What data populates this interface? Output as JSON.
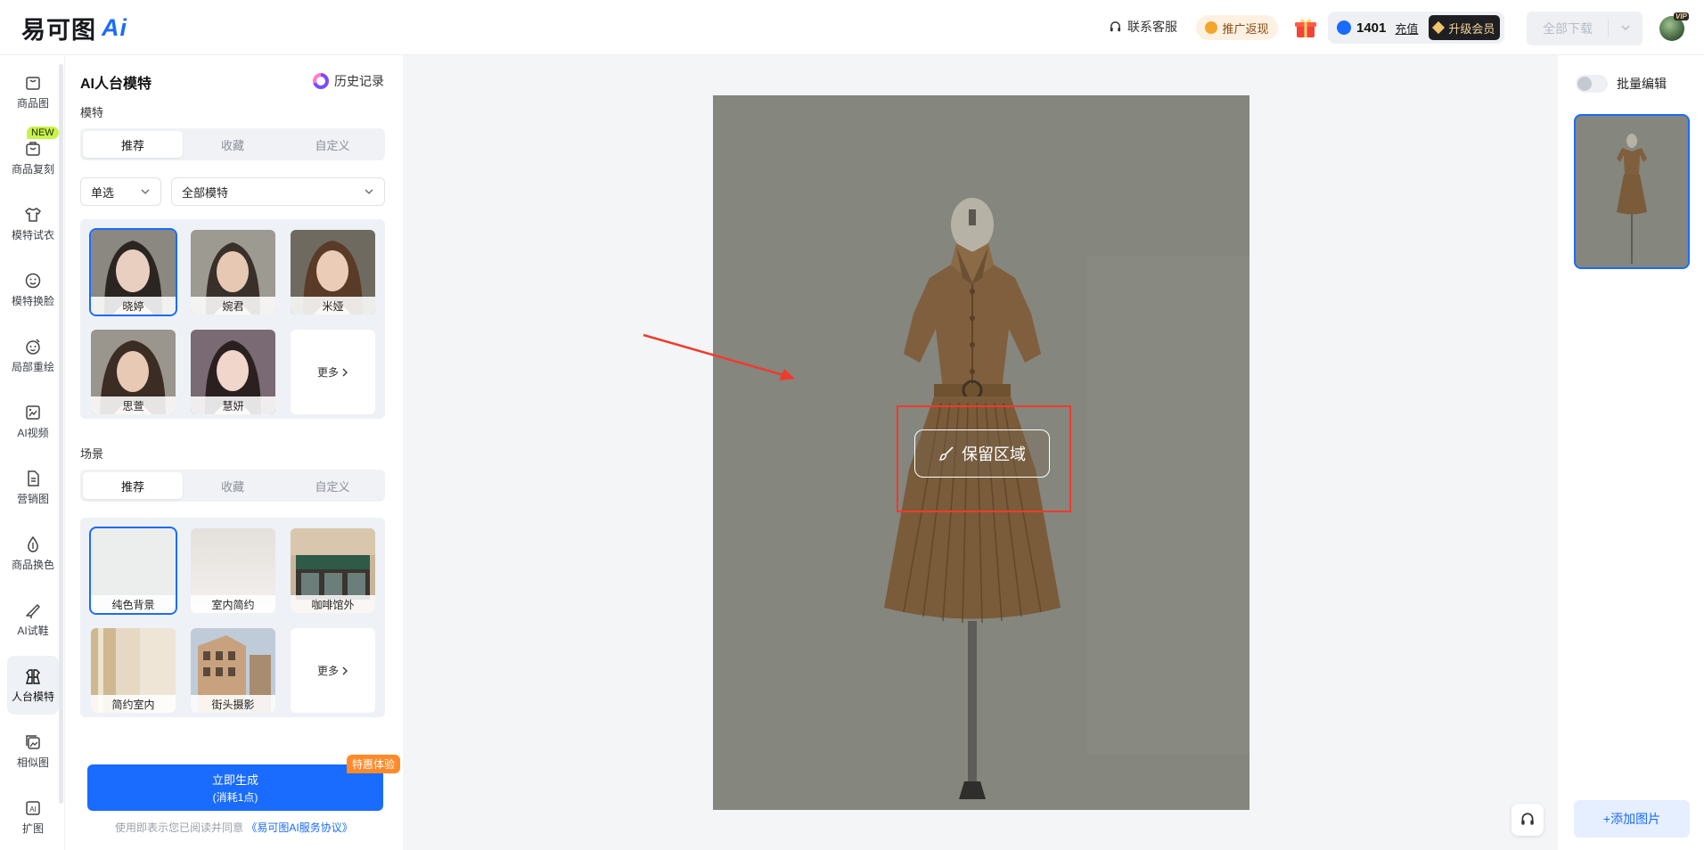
{
  "app": {
    "logo_text": "易可图",
    "logo_ai": "Ai"
  },
  "topbar": {
    "service_label": "联系客服",
    "promo_label": "推广返现",
    "credits": "1401",
    "recharge_label": "充值",
    "upgrade_label": "升级会员",
    "download_label": "全部下载",
    "vip_badge": "VIP"
  },
  "sidebar": {
    "new_badge": "NEW",
    "items": [
      {
        "label": "商品图",
        "icon": "shopping-bag-icon"
      },
      {
        "label": "商品复刻",
        "icon": "bag-copy-icon"
      },
      {
        "label": "模特试衣",
        "icon": "tshirt-icon"
      },
      {
        "label": "模特换脸",
        "icon": "face-icon"
      },
      {
        "label": "局部重绘",
        "icon": "face-edit-icon"
      },
      {
        "label": "AI视频",
        "icon": "video-icon"
      },
      {
        "label": "营销图",
        "icon": "document-icon"
      },
      {
        "label": "商品换色",
        "icon": "color-drop-icon"
      },
      {
        "label": "AI试鞋",
        "icon": "shoe-icon"
      },
      {
        "label": "人台模特",
        "icon": "mannequin-icon",
        "active": true
      },
      {
        "label": "相似图",
        "icon": "images-icon"
      },
      {
        "label": "扩图",
        "icon": "expand-ai-icon"
      }
    ]
  },
  "panel": {
    "title": "AI人台模特",
    "history_label": "历史记录",
    "model_section": {
      "label": "模特",
      "tabs": [
        "推荐",
        "收藏",
        "自定义"
      ],
      "active_tab": "推荐",
      "mode_select": "单选",
      "filter_select": "全部模特",
      "models": [
        "晓婷",
        "婉君",
        "米娅",
        "思萱",
        "慧妍"
      ],
      "selected_model": "晓婷",
      "more_label": "更多"
    },
    "scene_section": {
      "label": "场景",
      "tabs": [
        "推荐",
        "收藏",
        "自定义"
      ],
      "active_tab": "推荐",
      "scenes": [
        "纯色背景",
        "室内简约",
        "咖啡馆外",
        "简约室内",
        "街头摄影"
      ],
      "selected_scene": "纯色背景",
      "more_label": "更多"
    },
    "generate": {
      "label": "立即生成",
      "cost": "(消耗1点)",
      "badge": "特惠体验"
    },
    "agreement": {
      "text": "使用即表示您已阅读并同意",
      "link": "《易可图AI服务协议》"
    }
  },
  "canvas": {
    "keep_area_label": "保留区域",
    "colors": {
      "annotation": "#ef3b2d",
      "dress": "#7f5f3d",
      "background": "#86877e"
    }
  },
  "right_panel": {
    "batch_edit_label": "批量编辑",
    "add_image_label": "+添加图片"
  },
  "theme": {
    "accent": "#1a6bff",
    "badge_new": "#c9f24b",
    "badge_promo": "#ff8a2a"
  }
}
